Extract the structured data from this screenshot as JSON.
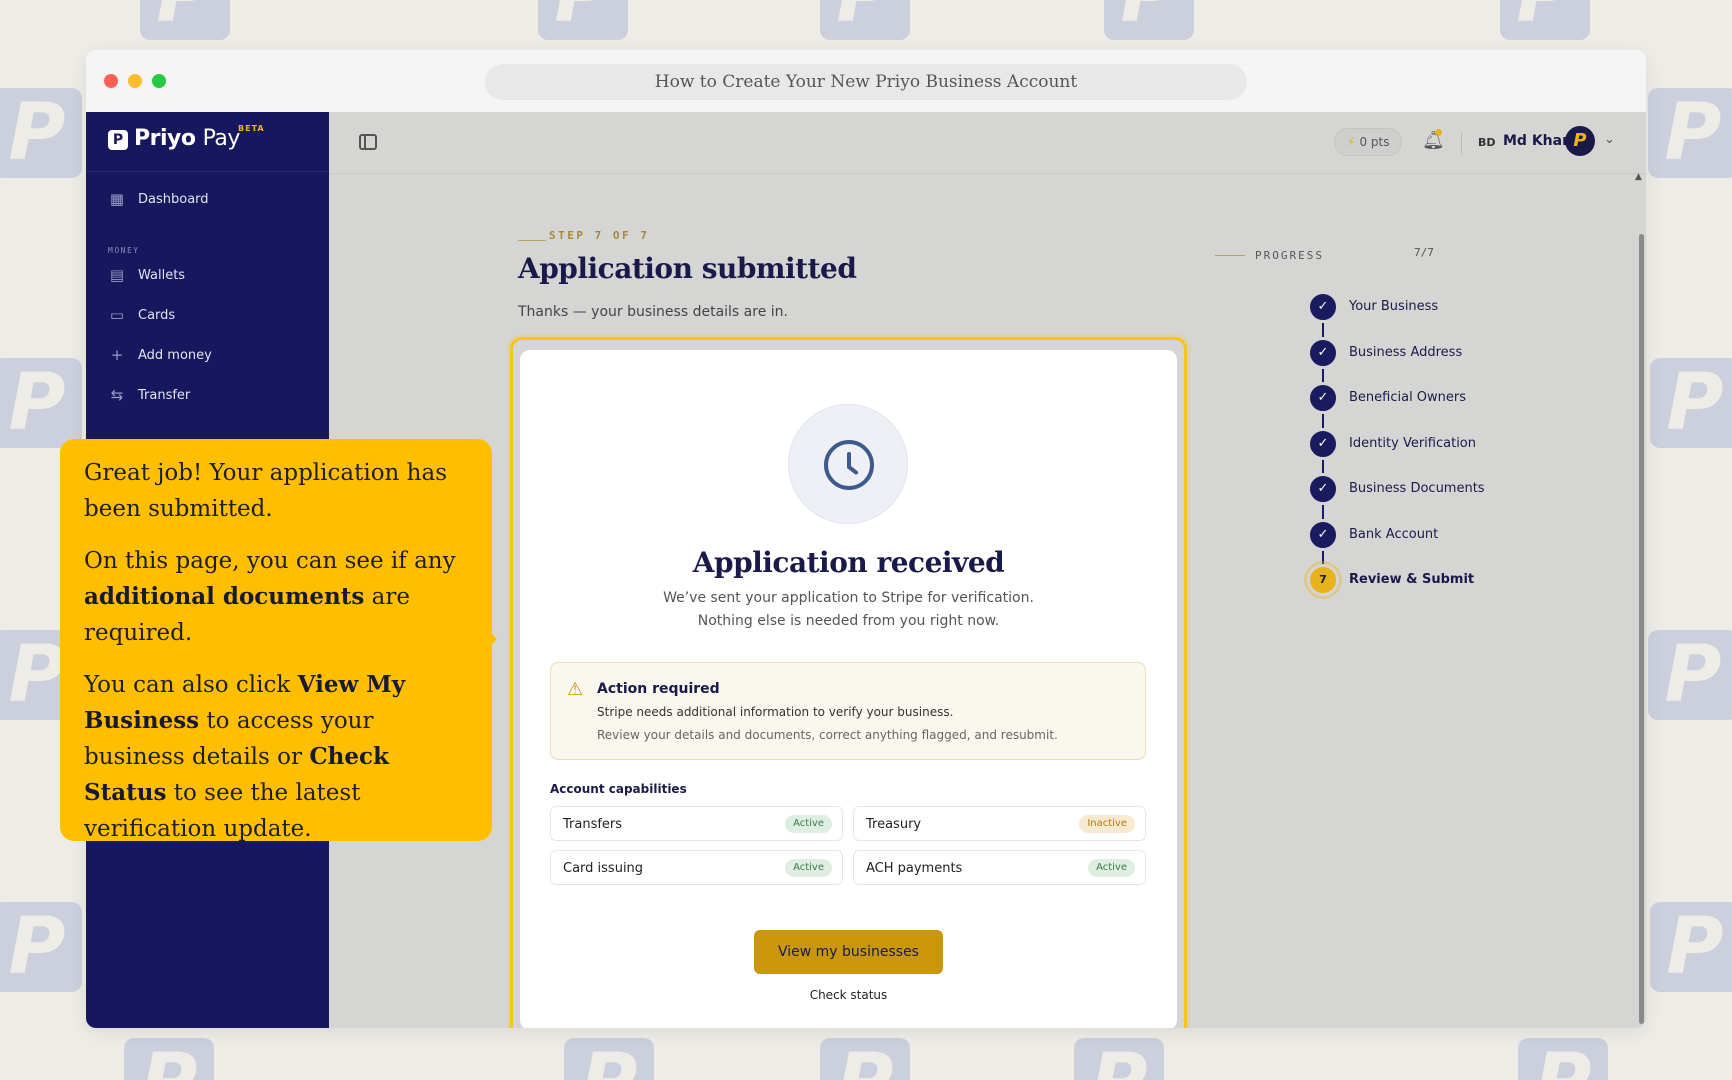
{
  "window": {
    "title": "How to Create Your New Priyo Business Account"
  },
  "brand": {
    "name_primary": "Priyo",
    "name_secondary": "Pay",
    "badge": "BETA"
  },
  "sidebar": {
    "items": [
      {
        "label": "Dashboard",
        "icon": "grid-icon"
      },
      {
        "label": "Wallets",
        "icon": "wallet-icon"
      },
      {
        "label": "Cards",
        "icon": "card-icon"
      },
      {
        "label": "Add money",
        "icon": "plus-icon"
      },
      {
        "label": "Transfer",
        "icon": "transfer-icon"
      }
    ],
    "section_money": "MONEY"
  },
  "topbar": {
    "points": "0 pts",
    "country": "BD",
    "user_name": "Md Khan"
  },
  "step": {
    "label": "STEP 7 OF 7",
    "title": "Application submitted",
    "subtitle": "Thanks — your business details are in."
  },
  "card": {
    "title": "Application received",
    "line1": "We’ve sent your application to Stripe for verification.",
    "line2": "Nothing else is needed from you right now.",
    "action": {
      "title": "Action required",
      "line1": "Stripe needs additional information to verify your business.",
      "line2": "Review your details and documents, correct anything flagged, and resubmit."
    },
    "capabilities_label": "Account capabilities",
    "capabilities": [
      {
        "name": "Transfers",
        "status": "Active"
      },
      {
        "name": "Treasury",
        "status": "Inactive"
      },
      {
        "name": "Card issuing",
        "status": "Active"
      },
      {
        "name": "ACH payments",
        "status": "Active"
      }
    ],
    "primary_button": "View my businesses",
    "secondary_link": "Check status"
  },
  "progress": {
    "label": "PROGRESS",
    "count": "7/7",
    "steps": [
      {
        "name": "Your Business",
        "marker": "✓"
      },
      {
        "name": "Business Address",
        "marker": "✓"
      },
      {
        "name": "Beneficial Owners",
        "marker": "✓"
      },
      {
        "name": "Identity Verification",
        "marker": "✓"
      },
      {
        "name": "Business Documents",
        "marker": "✓"
      },
      {
        "name": "Bank Account",
        "marker": "✓"
      },
      {
        "name": "Review & Submit",
        "marker": "7"
      }
    ]
  },
  "tooltip": {
    "p1": "Great job! Your application has been submitted.",
    "p2_pre": "On this page, you can see if any ",
    "p2_bold": "additional documents",
    "p2_post": " are required.",
    "p3_pre": "You can also click ",
    "p3_bold1": "View My Business",
    "p3_mid": " to access your business details or ",
    "p3_bold2": "Check Status",
    "p3_post": " to see the latest verification update."
  },
  "colors": {
    "sidebar_bg": "#17175e",
    "accent_gold": "#c9960c",
    "highlight_yellow": "#ffbf00"
  }
}
